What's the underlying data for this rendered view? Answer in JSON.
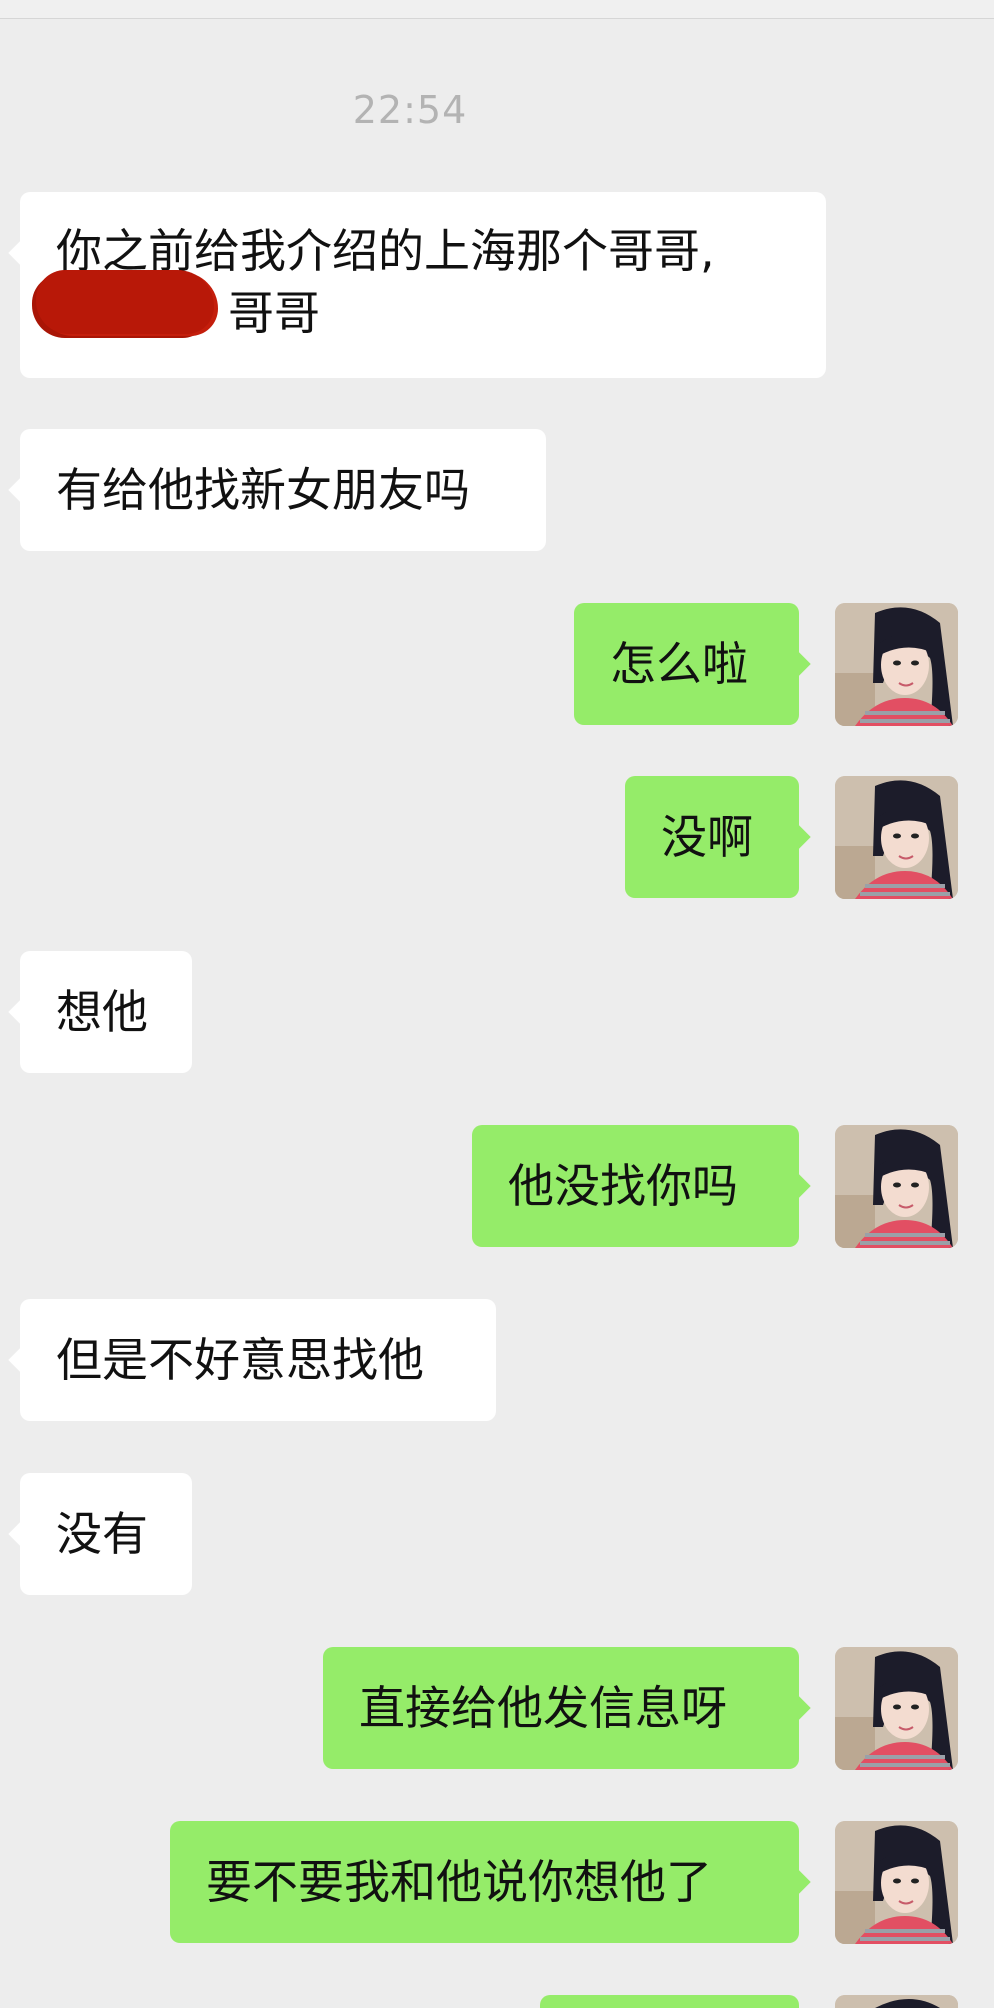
{
  "chat": {
    "timestamp": "22:54",
    "messages": [
      {
        "side": "left",
        "lines": [
          "你之前给我介绍的上海那个哥哥,",
          "哥哥"
        ],
        "redacted": true
      },
      {
        "side": "left",
        "lines": [
          "有给他找新女朋友吗"
        ]
      },
      {
        "side": "right",
        "lines": [
          "怎么啦"
        ],
        "avatar": "user-avatar-icon"
      },
      {
        "side": "right",
        "lines": [
          "没啊"
        ],
        "avatar": "user-avatar-icon"
      },
      {
        "side": "left",
        "lines": [
          "想他"
        ]
      },
      {
        "side": "right",
        "lines": [
          "他没找你吗"
        ],
        "avatar": "user-avatar-icon"
      },
      {
        "side": "left",
        "lines": [
          "但是不好意思找他"
        ]
      },
      {
        "side": "left",
        "lines": [
          "没有"
        ]
      },
      {
        "side": "right",
        "lines": [
          "直接给他发信息呀"
        ],
        "avatar": "user-avatar-icon"
      },
      {
        "side": "right",
        "lines": [
          "要不要我和他说你想他了"
        ],
        "avatar": "user-avatar-icon"
      },
      {
        "side": "right",
        "lines": [
          ""
        ],
        "avatar": "user-avatar-icon",
        "partial": true
      }
    ]
  },
  "colors": {
    "background": "#ededed",
    "incoming_bubble": "#ffffff",
    "outgoing_bubble": "#95ec69",
    "timestamp_text": "#b3b3b3",
    "redaction_mark": "#b81808"
  }
}
